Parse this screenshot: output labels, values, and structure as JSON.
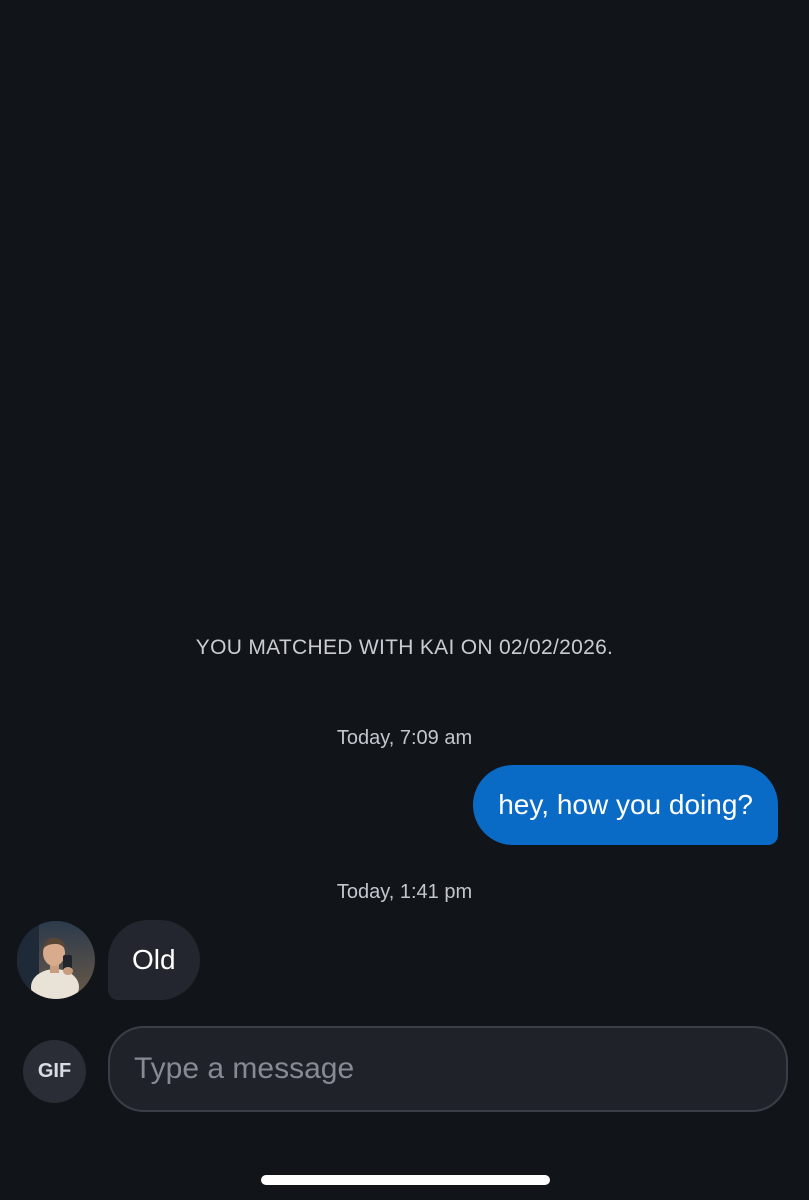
{
  "conversation": {
    "match_notice": "YOU MATCHED WITH KAI ON 02/02/2026.",
    "messages": [
      {
        "direction": "outgoing",
        "timestamp": "Today, 7:09 am",
        "text": "hey, how you doing?"
      },
      {
        "direction": "incoming",
        "timestamp": "Today, 1:41 pm",
        "text": "Old",
        "avatar": "contact-avatar"
      }
    ]
  },
  "composer": {
    "gif_label": "GIF",
    "placeholder": "Type a message",
    "value": ""
  },
  "colors": {
    "background": "#111419",
    "outgoing_bubble": "#0a6bc7",
    "incoming_bubble": "#23262e",
    "input_background": "#1f2229"
  }
}
